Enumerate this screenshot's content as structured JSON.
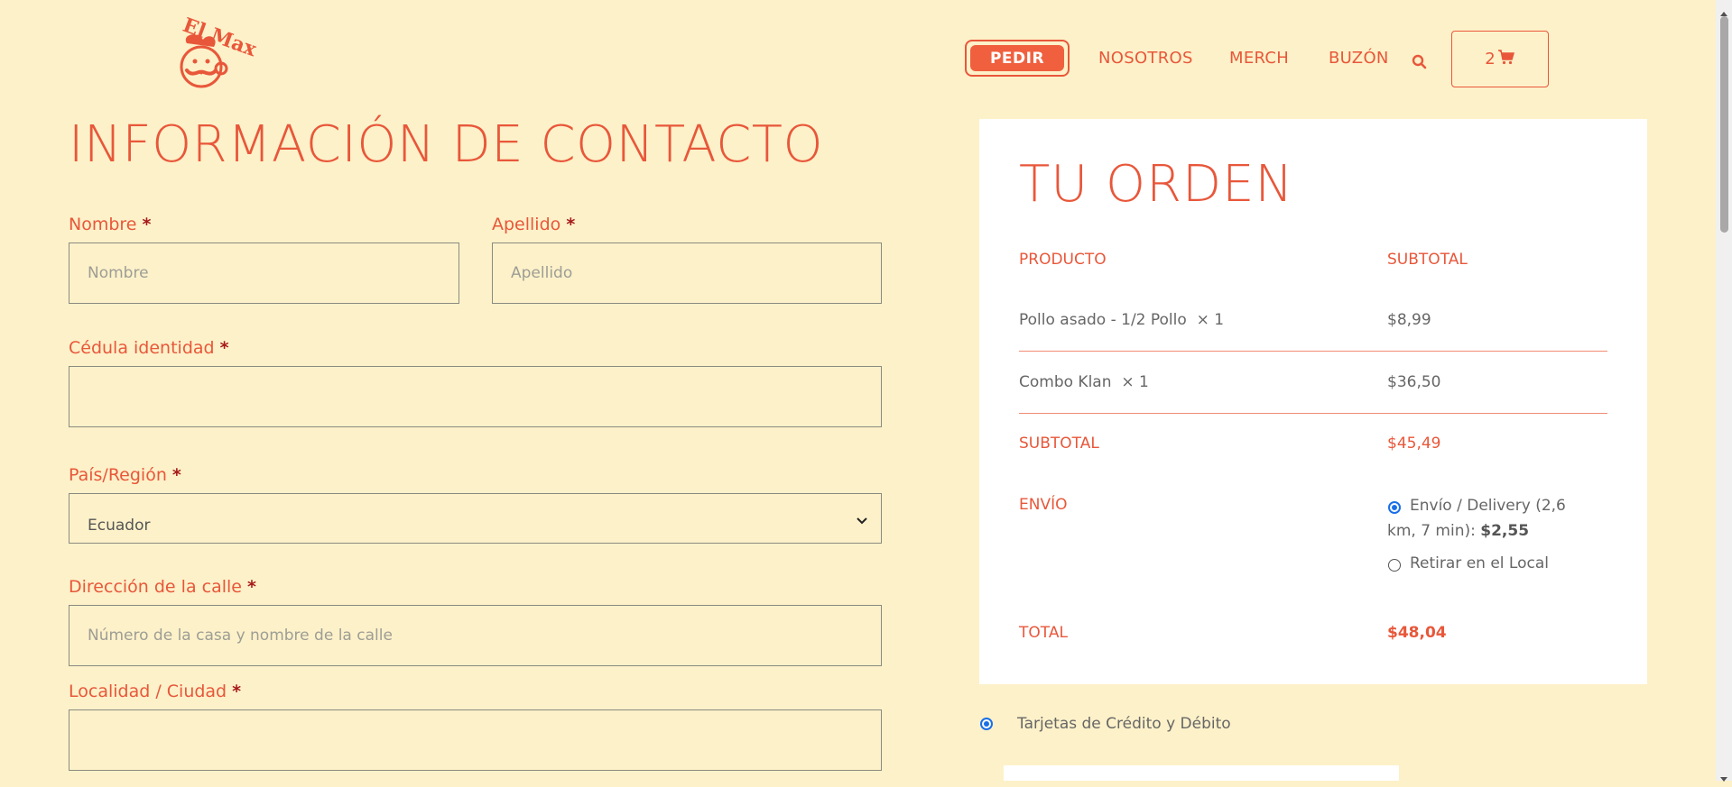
{
  "header": {
    "logo_text": "El Max",
    "nav": {
      "order_label": "PEDIR",
      "about_label": "NOSOTROS",
      "merch_label": "MERCH",
      "mailbox_label": "BUZÓN"
    },
    "cart_count": "2"
  },
  "contact": {
    "title": "INFORMACIÓN DE CONTACTO",
    "required_mark": "*",
    "first_name": {
      "label": "Nombre",
      "placeholder": "Nombre",
      "value": ""
    },
    "last_name": {
      "label": "Apellido",
      "placeholder": "Apellido",
      "value": ""
    },
    "id_card": {
      "label": "Cédula identidad",
      "placeholder": "",
      "value": ""
    },
    "country": {
      "label": "País/Región",
      "selected": "Ecuador"
    },
    "street": {
      "label": "Dirección de la calle",
      "placeholder": "Número de la casa y nombre de la calle",
      "value": ""
    },
    "city": {
      "label": "Localidad / Ciudad",
      "placeholder": "",
      "value": ""
    }
  },
  "order": {
    "title": "TU ORDEN",
    "col_product": "PRODUCTO",
    "col_subtotal": "SUBTOTAL",
    "items": [
      {
        "name": "Pollo asado - 1/2 Pollo",
        "qty": "× 1",
        "price": "$8,99"
      },
      {
        "name": "Combo Klan",
        "qty": "× 1",
        "price": "$36,50"
      }
    ],
    "subtotal_label": "SUBTOTAL",
    "subtotal_value": "$45,49",
    "shipping_label": "ENVÍO",
    "shipping_options": [
      {
        "label": "Envío / Delivery (2,6 km, 7 min):",
        "price": "$2,55",
        "selected": true
      },
      {
        "label": "Retirar en el Local",
        "selected": false
      }
    ],
    "total_label": "TOTAL",
    "total_value": "$48,04"
  },
  "payment": {
    "method_label": "Tarjetas de Crédito y Débito",
    "selected": true
  },
  "colors": {
    "background": "#fdf1c9",
    "accent": "#e8573a",
    "required": "#a61a1a",
    "radio": "#1a6fe8"
  }
}
